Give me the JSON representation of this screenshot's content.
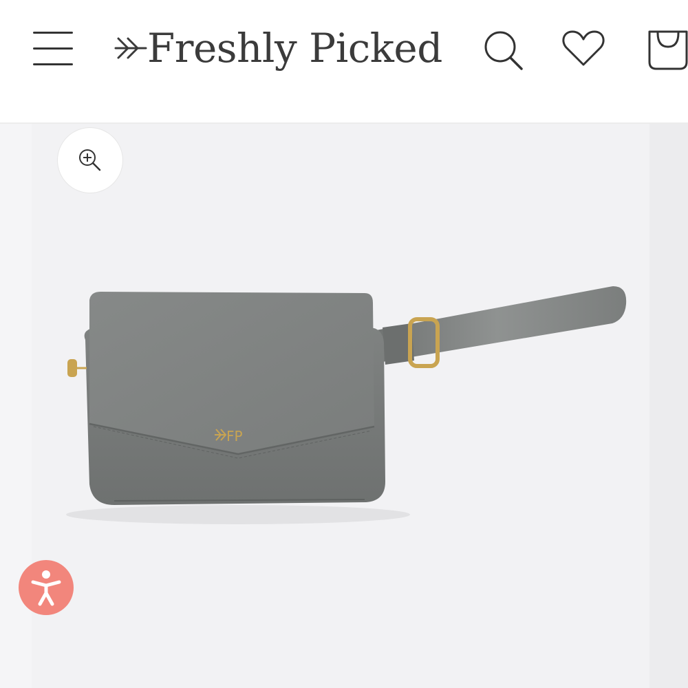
{
  "header": {
    "brand_name": "Freshly Picked",
    "icons": {
      "menu": "menu-icon",
      "logo_arrow": "arrow-logo-icon",
      "search": "search-icon",
      "wishlist": "heart-icon",
      "cart": "bag-icon"
    }
  },
  "gallery": {
    "zoom_icon": "zoom-in-icon",
    "product_image_alt": "grey leather belt bag with gold FP logo",
    "product_monogram": "FP"
  },
  "accessibility": {
    "icon": "accessibility-icon"
  },
  "colors": {
    "text": "#3b3b3b",
    "gallery_bg": "#f2f2f4",
    "bag_grey": "#7c7f7e",
    "hardware_gold": "#c9a451",
    "accessibility_button": "#f2867c"
  }
}
